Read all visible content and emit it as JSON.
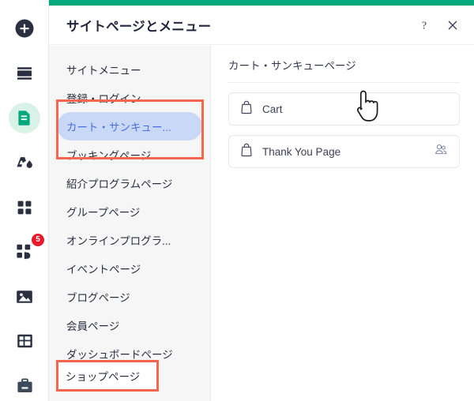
{
  "theme": {
    "accent_green": "#00a87e",
    "active_icon_bg": "#d9f2e7",
    "selected_item_bg": "#c9d8f7",
    "selected_item_text": "#4a6fe3",
    "annotation_red": "#f4674e",
    "badge_red": "#e8192c",
    "sidebar_bg": "#f6f6f7"
  },
  "rail": {
    "items": [
      {
        "name": "add-icon",
        "badge": ""
      },
      {
        "name": "sections-icon",
        "badge": ""
      },
      {
        "name": "pages-icon",
        "badge": ""
      },
      {
        "name": "design-icon",
        "badge": ""
      },
      {
        "name": "apps-grid-icon",
        "badge": ""
      },
      {
        "name": "add-apps-icon",
        "badge": "5"
      },
      {
        "name": "media-icon",
        "badge": ""
      },
      {
        "name": "layout-icon",
        "badge": ""
      },
      {
        "name": "business-icon",
        "badge": ""
      }
    ]
  },
  "header": {
    "title": "サイトページとメニュー",
    "help_label": "?",
    "close_label": "×"
  },
  "sidebar": {
    "items": [
      {
        "label": "サイトメニュー",
        "selected": false
      },
      {
        "label": "登録・ログイン",
        "selected": false
      },
      {
        "label": "カート・サンキュー...",
        "selected": true
      },
      {
        "label": "ブッキングページ",
        "selected": false
      },
      {
        "label": "紹介プログラムページ",
        "selected": false
      },
      {
        "label": "グループページ",
        "selected": false
      },
      {
        "label": "オンラインプログラ...",
        "selected": false
      },
      {
        "label": "イベントページ",
        "selected": false
      },
      {
        "label": "ブログページ",
        "selected": false
      },
      {
        "label": "会員ページ",
        "selected": false
      },
      {
        "label": "ダッシュボードページ",
        "selected": false
      }
    ],
    "highlighted_item": "ショップページ"
  },
  "content": {
    "title": "カート・サンキューページ",
    "pages": [
      {
        "label": "Cart",
        "icon": "shopping-bag-icon",
        "trailing_icon": ""
      },
      {
        "label": "Thank You Page",
        "icon": "shopping-bag-icon",
        "trailing_icon": "members-icon"
      }
    ]
  }
}
